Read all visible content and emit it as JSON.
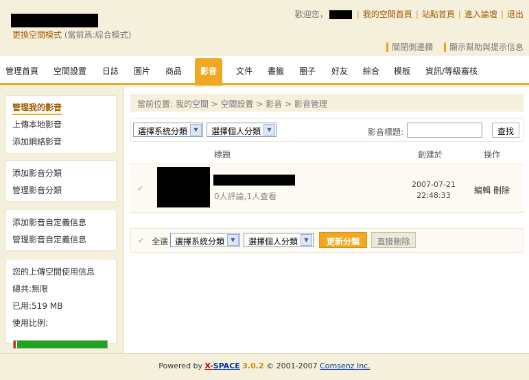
{
  "header": {
    "switch_link": "更換空間模式",
    "switch_note": "(當前爲:綜合模式)",
    "welcome": "歡迎您，",
    "sep": "|",
    "links": [
      "我的空間首頁",
      "站點首頁",
      "進入論壇",
      "退出"
    ],
    "toggles": [
      "關閉側邊欄",
      "顯示幫助與提示信息"
    ]
  },
  "nav": {
    "items": [
      "管理首頁",
      "空間設置",
      "日誌",
      "圖片",
      "商品",
      "影音",
      "文件",
      "書籤",
      "圈子",
      "好友",
      "綜合",
      "模板",
      "資訊/等級審核"
    ],
    "active_index": 5
  },
  "sidebar": {
    "group1": [
      "管理我的影音",
      "上傳本地影音",
      "添加網絡影音"
    ],
    "group2": [
      "添加影音分類",
      "管理影音分類"
    ],
    "group3": [
      "添加影音自定義信息",
      "管理影音自定義信息"
    ],
    "usage": {
      "title": "您的上傳空間使用信息",
      "total": "總共:無限",
      "used": "已用:519 MB",
      "ratio_label": "使用比例:",
      "used_fraction": 0.02,
      "used_color": "#cc3333",
      "free_color": "#1aa81a"
    }
  },
  "main": {
    "breadcrumb": "當前位置: 我的空間 > 空間設置 > 影音 > 影音管理",
    "filter": {
      "system_category": "選擇系統分類",
      "personal_category": "選擇個人分類",
      "search_label": "影音標題:",
      "search_value": "",
      "find_button": "查找"
    },
    "table": {
      "headers": {
        "title": "標題",
        "created": "創建於",
        "ops": "操作"
      },
      "rows": [
        {
          "stats": "0人評論,1人查看",
          "date": "2007-07-21",
          "time": "22:48:33",
          "edit": "編輯",
          "delete": "刪除"
        }
      ]
    },
    "bottom": {
      "select_all": "全選",
      "system_category": "選擇系統分類",
      "personal_category": "選擇個人分類",
      "update_button": "更新分類",
      "delete_button": "直接刪除"
    }
  },
  "footer": {
    "powered": "Powered by",
    "brand_x": "X-",
    "brand_space": "SPACE",
    "version": "3.0.2",
    "copyright": "© 2001-2007",
    "company": "Comsenz Inc."
  },
  "colors": {
    "accent": "#f0a820",
    "link": "#a05a00",
    "background": "#f5f0dc"
  },
  "icons": {
    "checkbox": "check-icon",
    "dropdown": "chevron-down-icon"
  }
}
